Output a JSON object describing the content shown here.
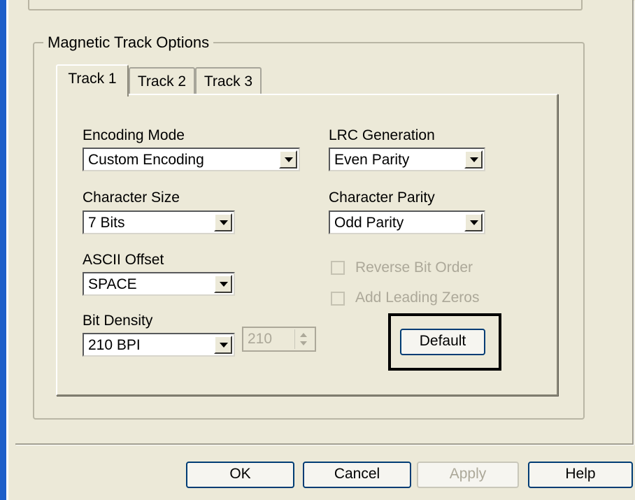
{
  "group": {
    "title": "Magnetic Track Options"
  },
  "tabs": [
    {
      "label": "Track 1"
    },
    {
      "label": "Track 2"
    },
    {
      "label": "Track 3"
    }
  ],
  "encoding_mode": {
    "label": "Encoding Mode",
    "value": "Custom Encoding"
  },
  "character_size": {
    "label": "Character Size",
    "value": "7 Bits"
  },
  "ascii_offset": {
    "label": "ASCII Offset",
    "value": "SPACE"
  },
  "bit_density": {
    "label": "Bit Density",
    "value": "210 BPI",
    "spin_value": "210"
  },
  "lrc_generation": {
    "label": "LRC Generation",
    "value": "Even Parity"
  },
  "character_parity": {
    "label": "Character Parity",
    "value": "Odd Parity"
  },
  "reverse_bit_order": {
    "label": "Reverse Bit Order",
    "checked": false,
    "enabled": false
  },
  "add_leading_zeros": {
    "label": "Add Leading Zeros",
    "checked": false,
    "enabled": false
  },
  "default_button": {
    "label": "Default"
  },
  "footer": {
    "ok": "OK",
    "cancel": "Cancel",
    "apply": "Apply",
    "help": "Help"
  },
  "colors": {
    "xp_blue": "#1c5ec9",
    "dialog_bg": "#ece9d8",
    "button_border": "#003c74",
    "disabled_text": "#aca899"
  }
}
